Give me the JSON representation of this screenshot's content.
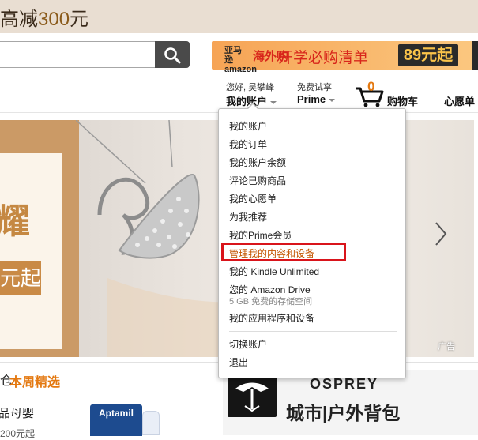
{
  "top_banner": {
    "text_prefix": "高减",
    "amount": "300",
    "suffix": "元"
  },
  "search": {
    "value": "",
    "placeholder": ""
  },
  "haitao_promo": {
    "logo": "亚马逊 amazon",
    "brand": "海外购",
    "title": "开学必购清单",
    "price": "89元起"
  },
  "nav": {
    "greeting": "您好, 吴攀峰",
    "account": "我的账户",
    "prime_top": "免费试享",
    "prime": "Prime",
    "cart_count": "0",
    "cart": "购物车",
    "wishlist": "心愿单"
  },
  "hero": {
    "char": "耀",
    "pill": "元起",
    "ad_label": "广告"
  },
  "account_menu": {
    "items": [
      "我的账户",
      "我的订单",
      "我的账户余额",
      "评论已购商品",
      "我的心愿单",
      "为我推荐",
      "我的Prime会员",
      "管理我的内容和设备",
      "我的 Kindle Unlimited",
      "您的 Amazon Drive",
      "我的应用程序和设备"
    ],
    "drive_note": "5 GB 免费的存储空间",
    "bottom_items": [
      "切换账户",
      "退出"
    ],
    "highlight_color": "#d9141b"
  },
  "bottom": {
    "left_char": "仓",
    "weekly_pick": "本周精选",
    "category": "品母婴",
    "subtext": "200元起",
    "aptamil": "Aptamil",
    "osprey_brand": "OSPREY",
    "osprey_slogan": "城市|户外背包"
  },
  "colors": {
    "accent": "#e47911",
    "search_button": "#4a4a4a",
    "highlight": "#d9141b"
  }
}
